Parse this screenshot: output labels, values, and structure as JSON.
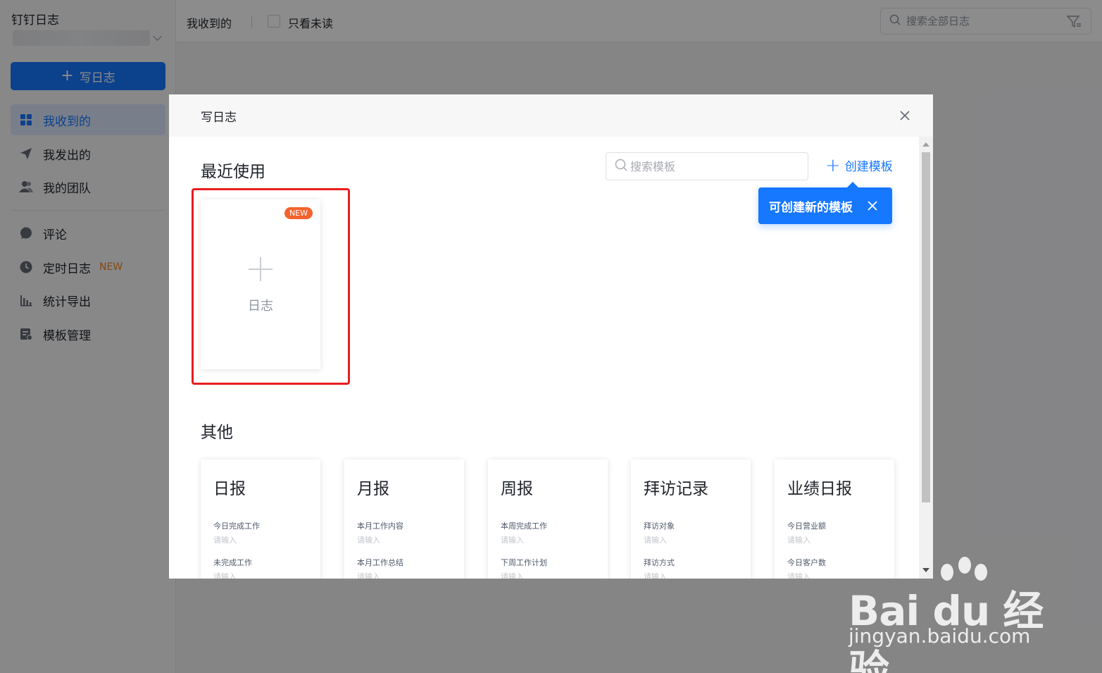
{
  "sidebar": {
    "app_title": "钉钉日志",
    "write_button": "写日志",
    "items": [
      {
        "label": "我收到的",
        "icon": "grid-icon"
      },
      {
        "label": "我发出的",
        "icon": "send-icon"
      },
      {
        "label": "我的团队",
        "icon": "team-icon"
      },
      {
        "label": "评论",
        "icon": "comment-icon"
      },
      {
        "label": "定时日志",
        "icon": "clock-icon",
        "badge": "NEW"
      },
      {
        "label": "统计导出",
        "icon": "bar-chart-icon"
      },
      {
        "label": "模板管理",
        "icon": "template-icon"
      }
    ]
  },
  "topbar": {
    "tab": "我收到的",
    "unread_only": "只看未读",
    "search_placeholder": "搜索全部日志"
  },
  "modal": {
    "title": "写日志",
    "recent_title": "最近使用",
    "search_placeholder": "搜索模板",
    "create_template": "创建模板",
    "tooltip": "可创建新的模板",
    "new_card": {
      "badge": "NEW",
      "label": "日志"
    },
    "other_title": "其他",
    "templates": [
      {
        "title": "日报",
        "fields": [
          {
            "label": "今日完成工作",
            "ph": "请输入"
          },
          {
            "label": "未完成工作",
            "ph": "请输入"
          }
        ]
      },
      {
        "title": "月报",
        "fields": [
          {
            "label": "本月工作内容",
            "ph": "请输入"
          },
          {
            "label": "本月工作总结",
            "ph": "请输入"
          }
        ]
      },
      {
        "title": "周报",
        "fields": [
          {
            "label": "本周完成工作",
            "ph": "请输入"
          },
          {
            "label": "下周工作计划",
            "ph": "请输入"
          }
        ]
      },
      {
        "title": "拜访记录",
        "fields": [
          {
            "label": "拜访对象",
            "ph": "请输入"
          },
          {
            "label": "拜访方式",
            "ph": "请输入"
          }
        ]
      },
      {
        "title": "业绩日报",
        "fields": [
          {
            "label": "今日营业额",
            "ph": "请输入"
          },
          {
            "label": "今日客户数",
            "ph": "请输入"
          }
        ]
      }
    ]
  },
  "watermark": {
    "brand": "Bai du 经验",
    "url": "jingyan.baidu.com"
  },
  "colors": {
    "accent": "#1677ff",
    "highlight": "#e81e1e",
    "new_badge": "#f5622e"
  }
}
